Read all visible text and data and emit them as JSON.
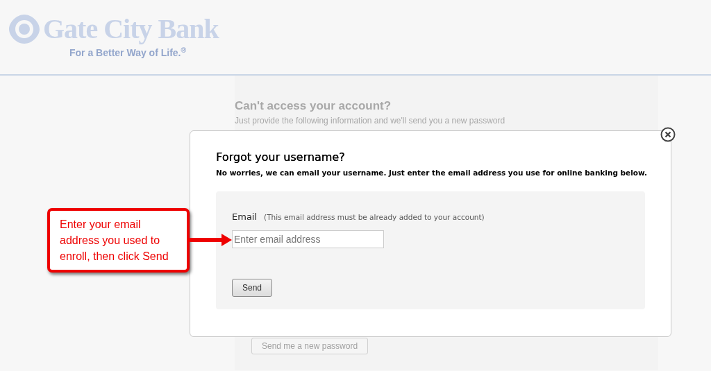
{
  "header": {
    "brand": "Gate City Bank",
    "tagline": "For a Better Way of Life.$^{®}$"
  },
  "background_form": {
    "title": "Can't access your account?",
    "text": "Just provide the following information and we'll send you a new password",
    "button": "Send me a new password"
  },
  "dialog": {
    "title": "Forgot your username?",
    "subtitle": "No worries, we can email your username. Just enter the email address you use for online banking below.",
    "email": {
      "label": "Email",
      "hint": "(This email address must be already added to your account)",
      "placeholder": "Enter email address"
    },
    "button": "Send"
  },
  "callout": {
    "text": "Enter your email address you used to enroll, then click Send"
  }
}
